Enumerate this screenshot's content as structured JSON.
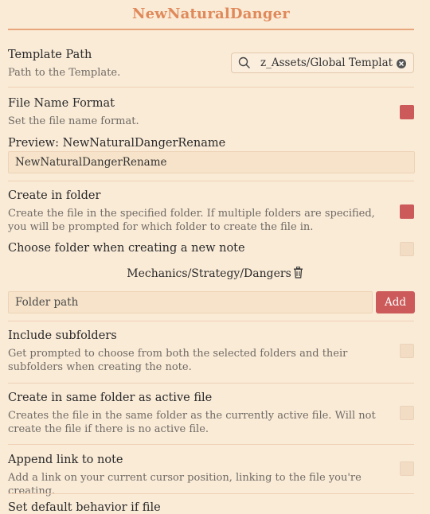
{
  "plugin_title": "NewNaturalDanger",
  "template_path": {
    "name": "Template Path",
    "desc": "Path to the Template.",
    "value": "z_Assets/Global Templates",
    "search_icon": "search-icon",
    "clear_icon": "clear-icon"
  },
  "file_name_format": {
    "name": "File Name Format",
    "desc": "Set the file name format.",
    "enabled": true
  },
  "preview": {
    "label": "Preview: NewNaturalDangerRename",
    "value": "NewNaturalDangerRename"
  },
  "create_in_folder": {
    "name": "Create in folder",
    "desc": "Create the file in the specified folder. If multiple folders are specified, you will be prompted for which folder to create the file in.",
    "enabled": true
  },
  "choose_folder": {
    "name": "Choose folder when creating a new note",
    "enabled": false
  },
  "folders": [
    {
      "path": "Mechanics/Strategy/Dangers",
      "icon": "trash-icon"
    }
  ],
  "folder_input": {
    "placeholder": "Folder path",
    "add_label": "Add"
  },
  "include_subfolders": {
    "name": "Include subfolders",
    "desc": "Get prompted to choose from both the selected folders and their subfolders when creating the note.",
    "enabled": false
  },
  "same_folder": {
    "name": "Create in same folder as active file",
    "desc": "Creates the file in the same folder as the currently active file. Will not create the file if there is no active file.",
    "enabled": false
  },
  "append_link": {
    "name": "Append link to note",
    "desc": "Add a link on your current cursor position, linking to the file you're creating.",
    "enabled": false
  },
  "default_behavior": {
    "name": "Set default behavior if file"
  },
  "colors": {
    "background": "#faebd7",
    "accent": "#cc5a5a",
    "title": "#e0895a"
  }
}
